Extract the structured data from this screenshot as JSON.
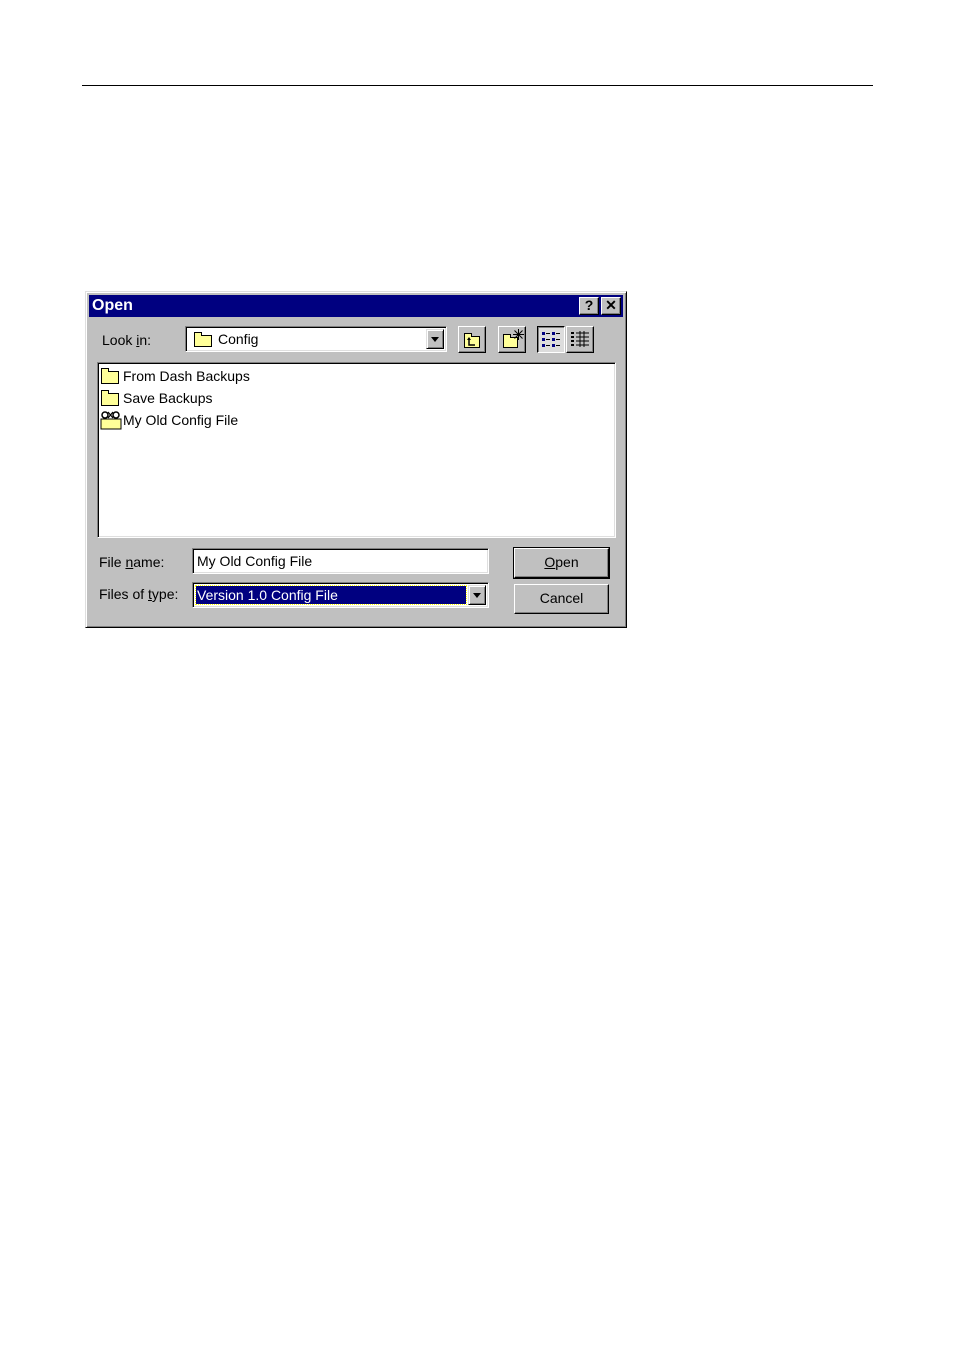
{
  "dialog": {
    "title": "Open",
    "help_button": "?",
    "close_button": "✕"
  },
  "look_in": {
    "label_pre": "Look ",
    "label_ul": "i",
    "label_post": "n:",
    "value": "Config"
  },
  "toolbar": {
    "up_one_level_icon": "up-folder-icon",
    "new_folder_icon": "new-folder-icon",
    "list_view_icon": "list-view-icon",
    "details_view_icon": "details-view-icon"
  },
  "files": [
    {
      "name": "From Dash Backups",
      "icon": "folder-icon"
    },
    {
      "name": "Save Backups",
      "icon": "folder-icon"
    },
    {
      "name": "My Old Config File",
      "icon": "config-file-icon"
    }
  ],
  "file_name": {
    "label_pre": "File ",
    "label_ul": "n",
    "label_post": "ame:",
    "value": "My Old Config File"
  },
  "file_type": {
    "label_pre": "Files of ",
    "label_ul": "t",
    "label_post": "ype:",
    "value": "Version 1.0 Config File"
  },
  "buttons": {
    "open_ul": "O",
    "open_post": "pen",
    "cancel": "Cancel"
  },
  "colors": {
    "titlebar": "#000080",
    "selection": "#000080",
    "face": "#c0c0c0",
    "folder": "#ffff99"
  }
}
